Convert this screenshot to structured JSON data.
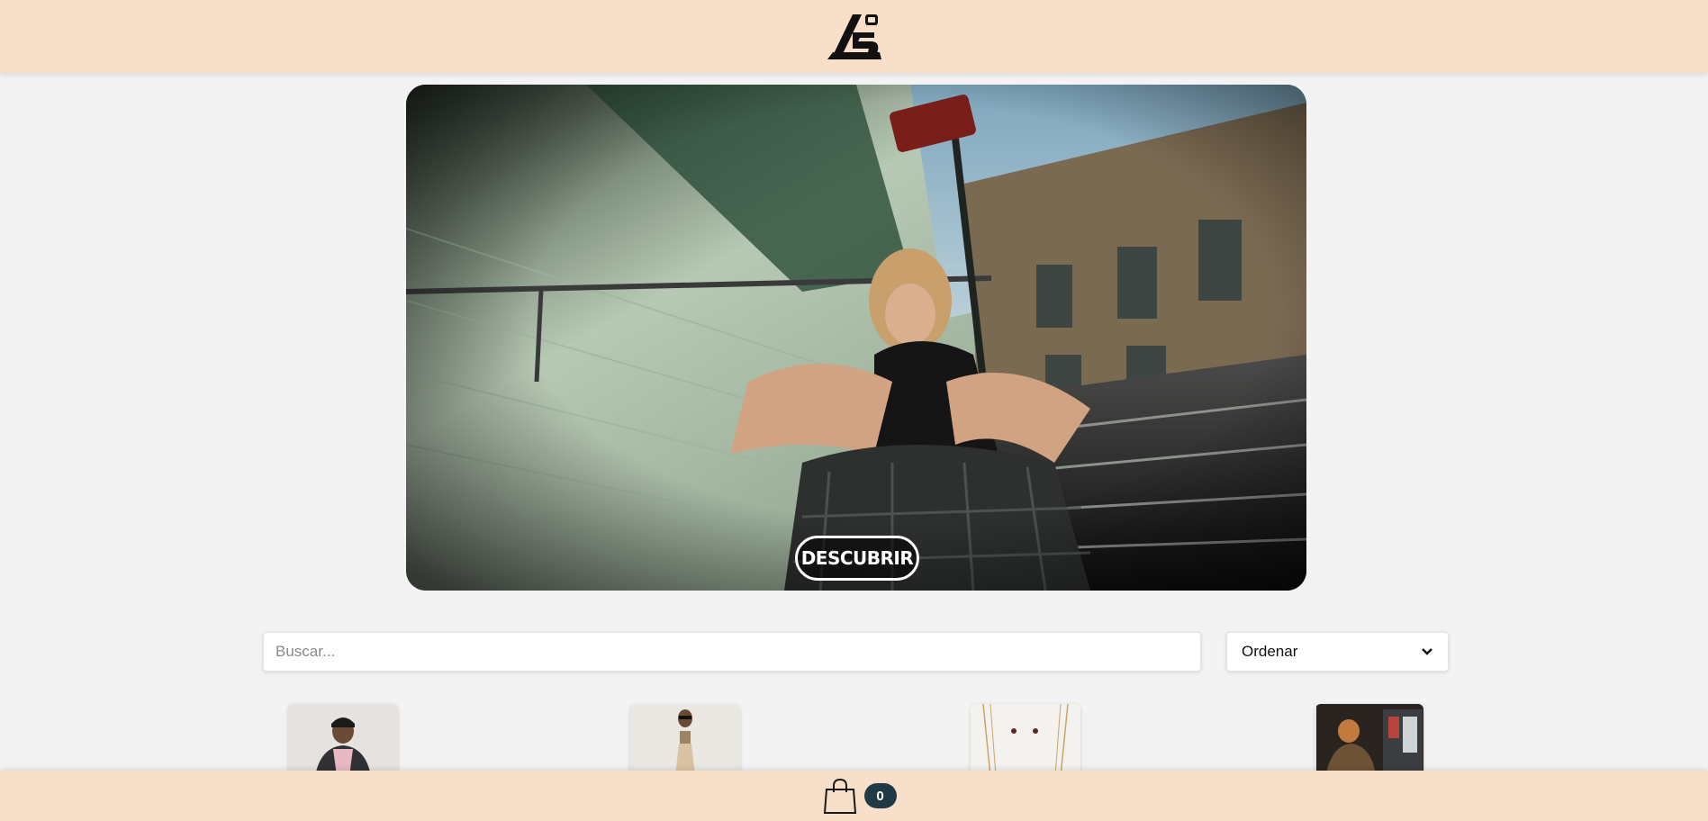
{
  "header": {
    "logo_icon": "brand-logo"
  },
  "hero": {
    "cta_label": "DESCUBRIR",
    "image": "woman-sitting-on-metro-stairs"
  },
  "search": {
    "placeholder": "Buscar..."
  },
  "sort": {
    "selected": "Ordenar",
    "icon": "chevron-down-icon"
  },
  "products": [
    {
      "image": "man-in-cap-and-jacket"
    },
    {
      "image": "woman-in-sunglasses"
    },
    {
      "image": "gold-necklaces"
    },
    {
      "image": "man-at-vending-machine"
    }
  ],
  "cart": {
    "icon": "shopping-bag-icon",
    "count": "0"
  },
  "colors": {
    "header_bg": "#f7dfc9",
    "page_bg": "#f3f3f3",
    "badge_bg": "#1f3a45"
  }
}
